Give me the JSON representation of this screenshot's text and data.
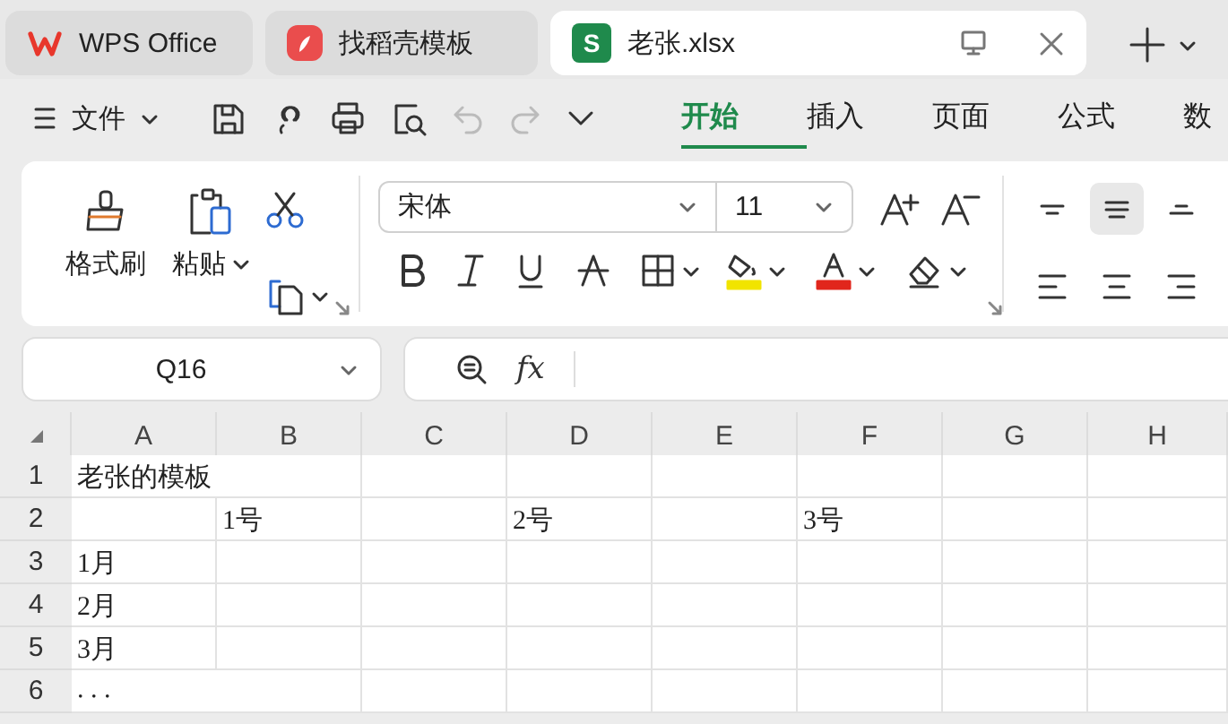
{
  "tabs": [
    {
      "label": "WPS Office",
      "kind": "wps",
      "selected": false
    },
    {
      "label": "找稻壳模板",
      "kind": "docer",
      "selected": false
    },
    {
      "label": "老张.xlsx",
      "kind": "sheet",
      "icon_text": "S",
      "selected": true
    }
  ],
  "menu": {
    "file": "文件",
    "ribbon_tabs": [
      {
        "label": "开始",
        "selected": true
      },
      {
        "label": "插入",
        "selected": false
      },
      {
        "label": "页面",
        "selected": false
      },
      {
        "label": "公式",
        "selected": false
      },
      {
        "label": "数",
        "selected": false
      }
    ]
  },
  "ribbon": {
    "format_painter": "格式刷",
    "paste": "粘贴",
    "font": "宋体",
    "size": "11",
    "align": [
      {
        "kind": "top",
        "selected": false
      },
      {
        "kind": "middle",
        "selected": true
      },
      {
        "kind": "bottom",
        "selected": false
      },
      {
        "kind": "left",
        "selected": false
      },
      {
        "kind": "center",
        "selected": false
      },
      {
        "kind": "right",
        "selected": false
      }
    ]
  },
  "formula_bar": {
    "name_box": "Q16",
    "fx": "fx"
  },
  "sheet": {
    "columns": [
      "A",
      "B",
      "C",
      "D",
      "E",
      "F",
      "G",
      "H"
    ],
    "rows": [
      {
        "header": "1",
        "cells": [
          "老张的模板",
          null,
          null,
          null,
          null,
          null,
          null,
          null
        ]
      },
      {
        "header": "2",
        "cells": [
          null,
          "1号",
          null,
          "2号",
          null,
          "3号",
          null,
          null
        ]
      },
      {
        "header": "3",
        "cells": [
          "1月",
          null,
          null,
          null,
          null,
          null,
          null,
          null
        ]
      },
      {
        "header": "4",
        "cells": [
          "2月",
          null,
          null,
          null,
          null,
          null,
          null,
          null
        ]
      },
      {
        "header": "5",
        "cells": [
          "3月",
          null,
          null,
          null,
          null,
          null,
          null,
          null
        ]
      },
      {
        "header": "6",
        "cells": [
          ". . .",
          null,
          null,
          null,
          null,
          null,
          null,
          null
        ]
      }
    ]
  }
}
